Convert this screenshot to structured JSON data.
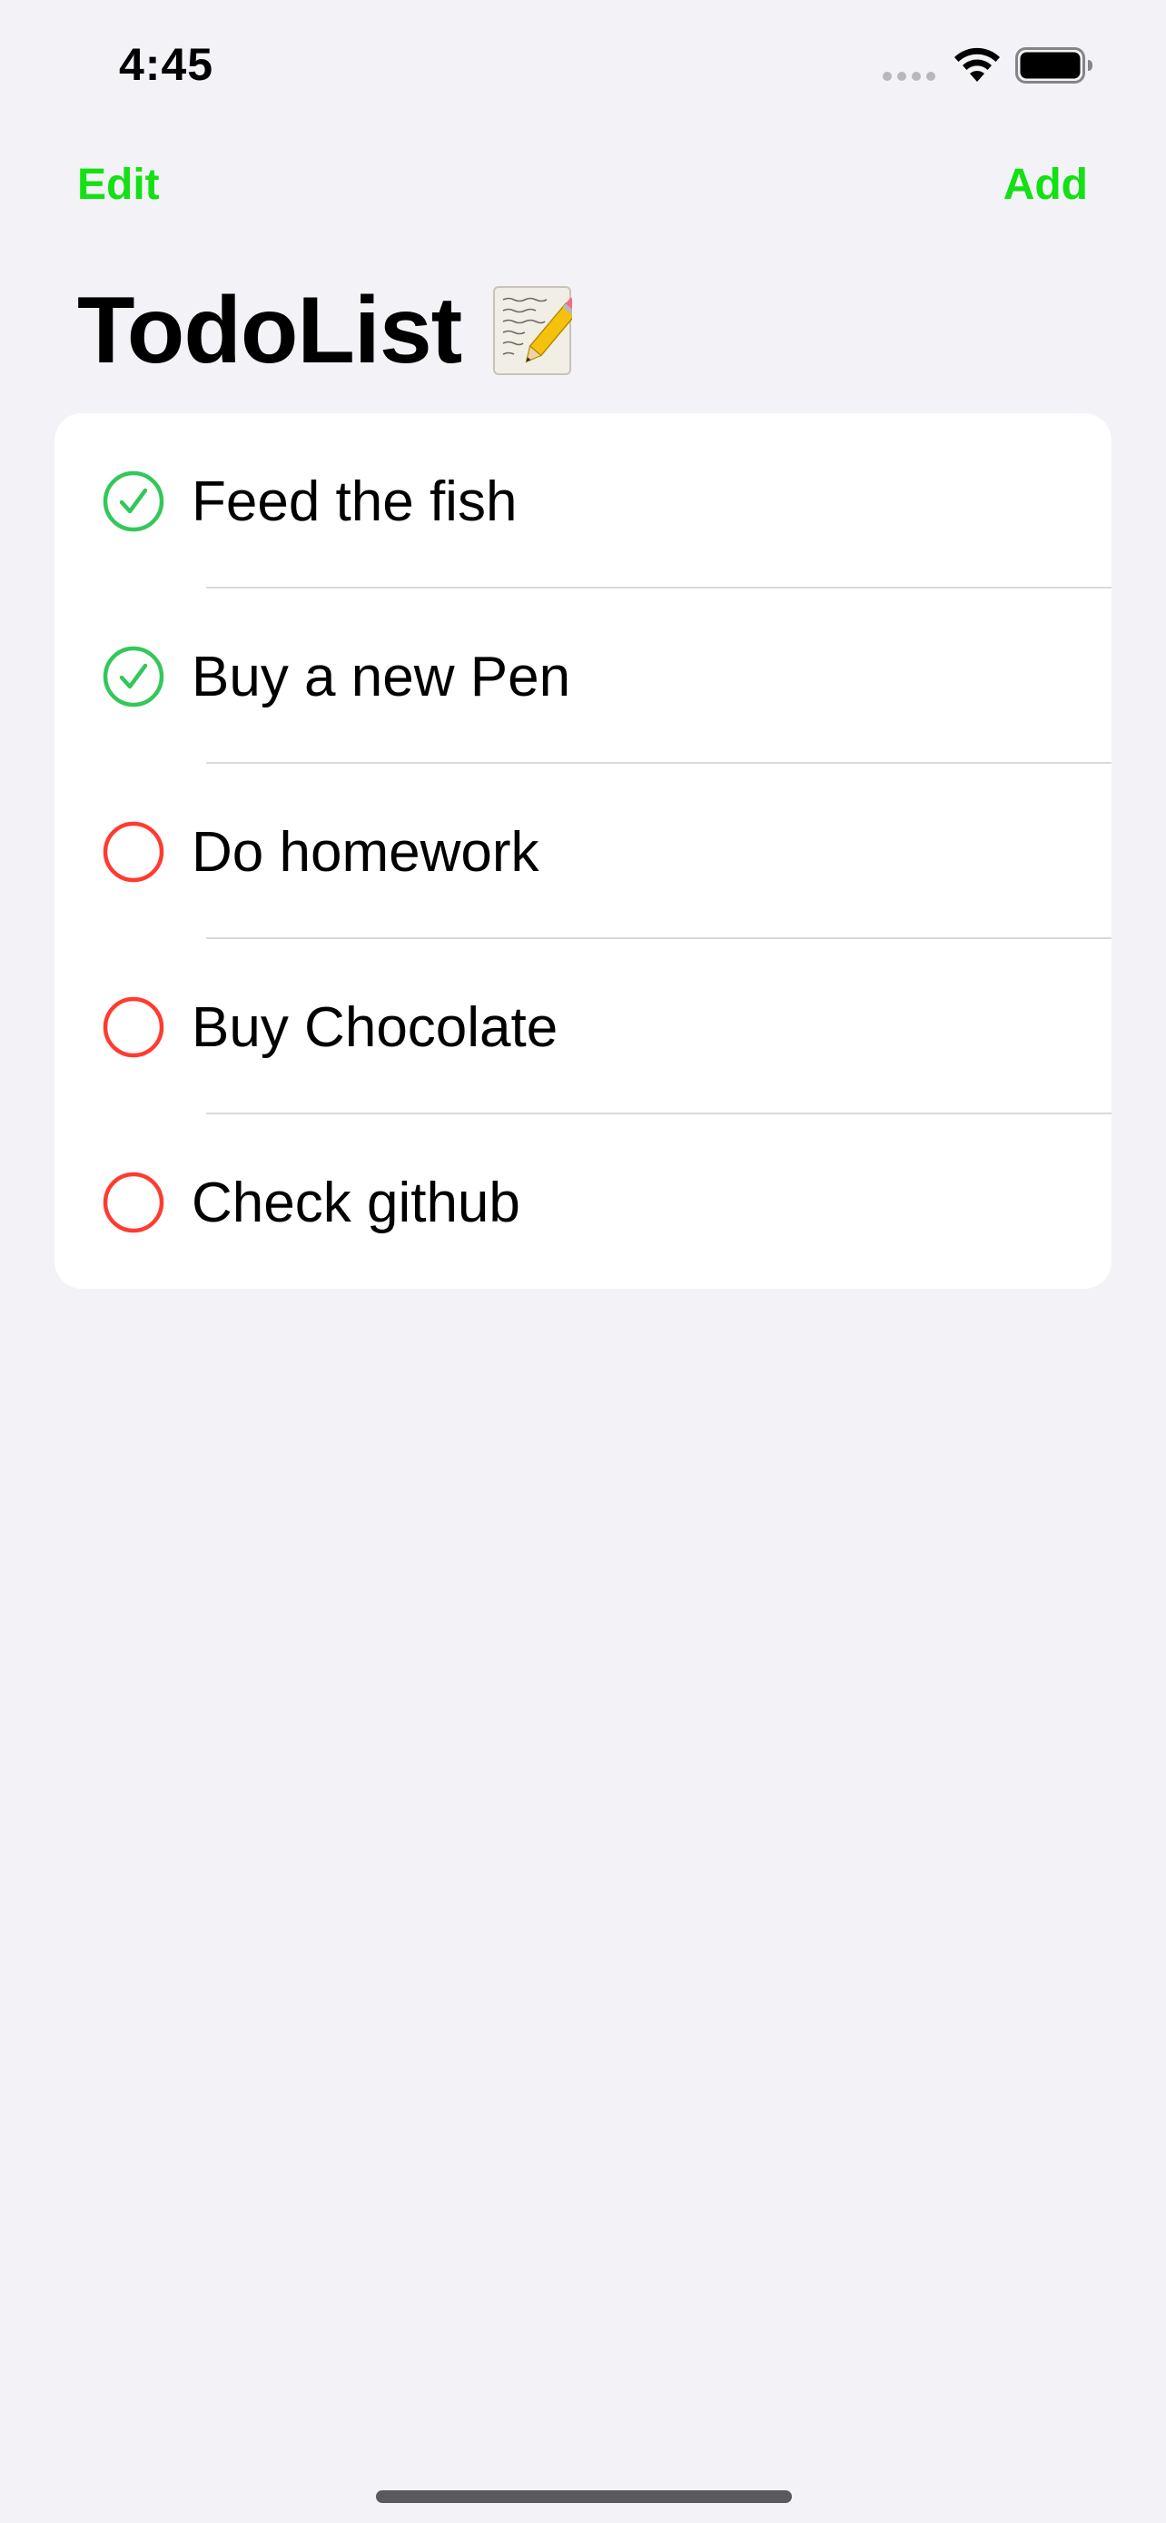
{
  "status_bar": {
    "time": "4:45"
  },
  "nav": {
    "edit_label": "Edit",
    "add_label": "Add",
    "accent_color": "#14e014"
  },
  "title": {
    "text": "TodoList",
    "icon": "memo-icon"
  },
  "todos": [
    {
      "label": "Feed the fish",
      "done": true
    },
    {
      "label": "Buy a new Pen",
      "done": true
    },
    {
      "label": "Do homework",
      "done": false
    },
    {
      "label": "Buy Chocolate",
      "done": false
    },
    {
      "label": "Check github",
      "done": false
    }
  ],
  "colors": {
    "done": "#34c759",
    "pending": "#ff3b30",
    "background": "#f2f2f7"
  }
}
